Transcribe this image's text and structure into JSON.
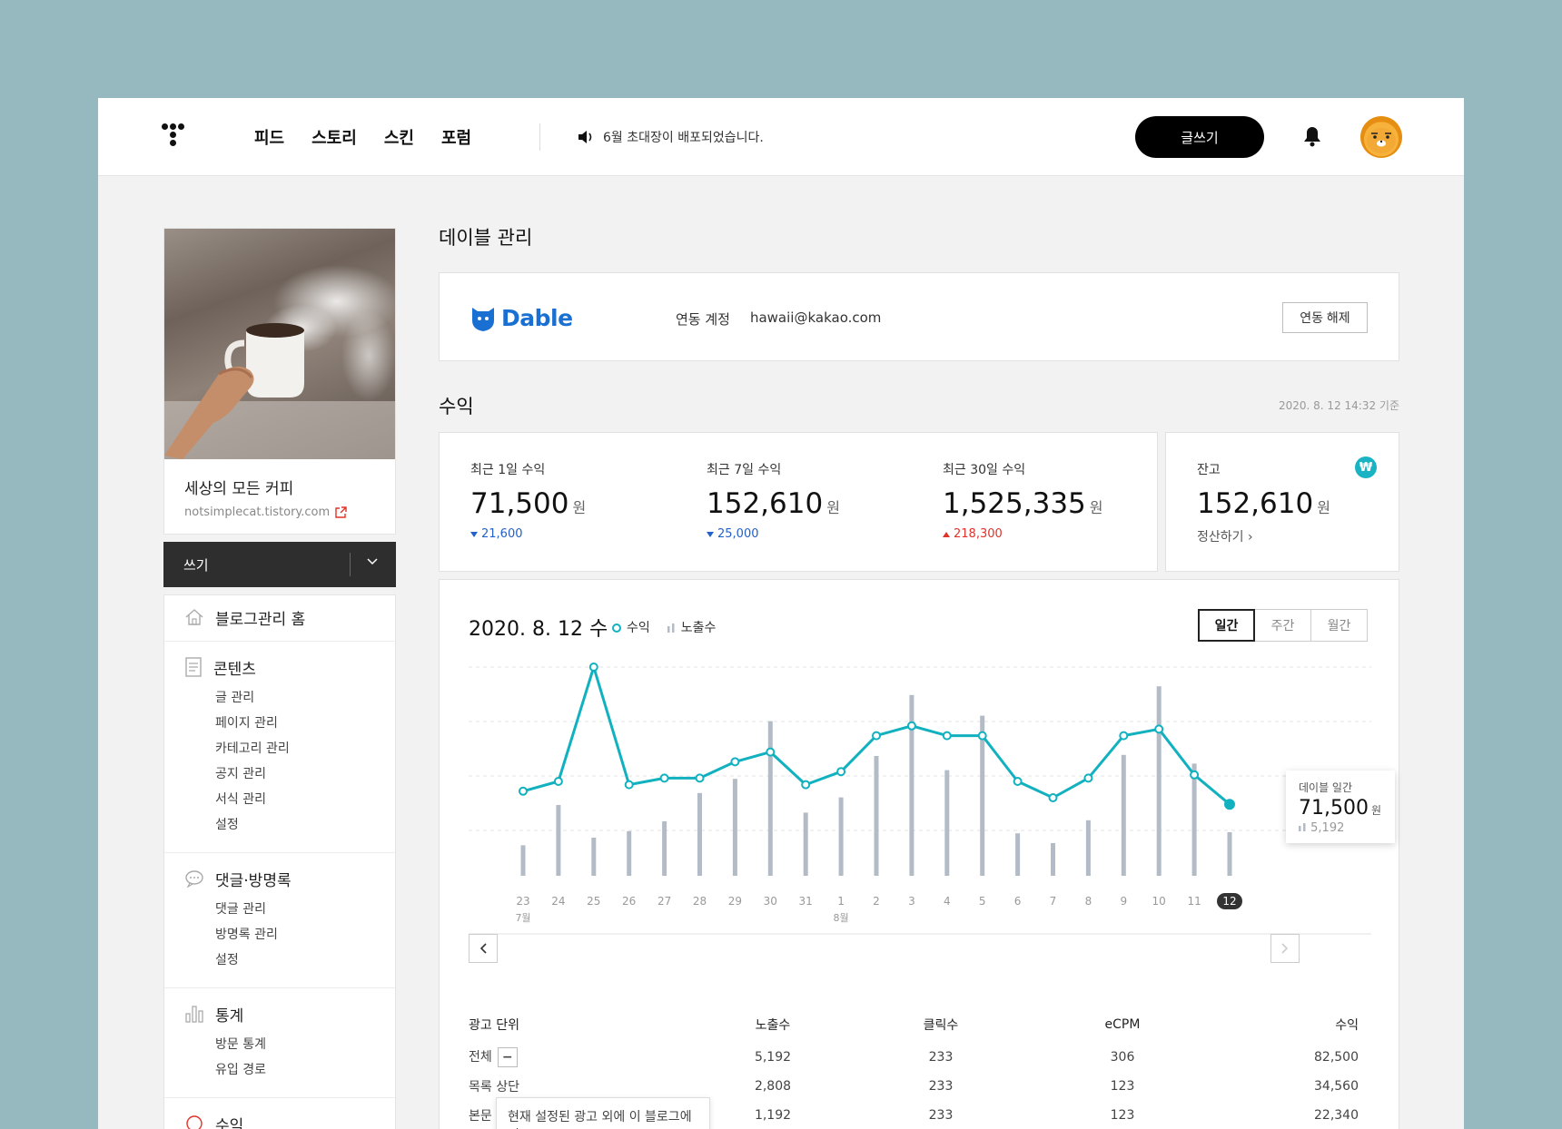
{
  "header": {
    "nav": [
      "피드",
      "스토리",
      "스킨",
      "포럼"
    ],
    "notice": "6월 초대장이 배포되었습니다.",
    "write_label": "글쓰기"
  },
  "sidebar": {
    "blog_title": "세상의 모든 커피",
    "blog_url": "notsimplecat.tistory.com",
    "write_label": "쓰기",
    "home_label": "블로그관리 홈",
    "groups": [
      {
        "title": "콘텐츠",
        "icon": "document-icon",
        "items": [
          "글 관리",
          "페이지 관리",
          "카테고리 관리",
          "공지 관리",
          "서식 관리",
          "설정"
        ]
      },
      {
        "title": "댓글·방명록",
        "icon": "comment-icon",
        "items": [
          "댓글 관리",
          "방명록 관리",
          "설정"
        ]
      },
      {
        "title": "통계",
        "icon": "stats-icon",
        "items": [
          "방문 통계",
          "유입 경로"
        ]
      }
    ],
    "next_group": "수익"
  },
  "dable": {
    "title": "데이블 관리",
    "logo_text": "Dable",
    "account_label": "연동 계정",
    "account_value": "hawaii@kakao.com",
    "unlink_label": "연동 해제"
  },
  "revenue": {
    "title": "수익",
    "as_of": "2020. 8. 12 14:32 기준",
    "stats": [
      {
        "label": "최근 1일 수익",
        "value": "71,500",
        "unit": "원",
        "delta": "21,600",
        "dir": "down"
      },
      {
        "label": "최근 7일 수익",
        "value": "152,610",
        "unit": "원",
        "delta": "25,000",
        "dir": "down"
      },
      {
        "label": "최근 30일 수익",
        "value": "1,525,335",
        "unit": "원",
        "delta": "218,300",
        "dir": "up"
      }
    ],
    "balance": {
      "label": "잔고",
      "value": "152,610",
      "unit": "원",
      "settle": "정산하기",
      "icon_text": "₩"
    }
  },
  "chart": {
    "date": "2020. 8. 12 수",
    "legend_revenue": "수익",
    "legend_views": "노출수",
    "periods": [
      "일간",
      "주간",
      "월간"
    ],
    "tooltip": {
      "title": "데이블 일간",
      "value": "71,500",
      "unit": "원",
      "views": "5,192"
    }
  },
  "chart_data": {
    "type": "line",
    "categories": [
      "23",
      "24",
      "25",
      "26",
      "27",
      "28",
      "29",
      "30",
      "31",
      "1",
      "2",
      "3",
      "4",
      "5",
      "6",
      "7",
      "8",
      "9",
      "10",
      "11",
      "12"
    ],
    "month_labels": {
      "0": "7월",
      "9": "8월"
    },
    "selected_index": 20,
    "series": [
      {
        "name": "수익",
        "kind": "line",
        "color": "#11b1bf",
        "values": [
          62,
          65,
          100,
          64,
          66,
          66,
          71,
          74,
          64,
          68,
          79,
          82,
          79,
          79,
          65,
          60,
          66,
          79,
          81,
          67,
          58
        ]
      },
      {
        "name": "노출수",
        "kind": "bar",
        "color": "#b3bcc6",
        "values": [
          28,
          65,
          35,
          41,
          50,
          76,
          89,
          142,
          58,
          72,
          110,
          166,
          97,
          147,
          39,
          30,
          51,
          111,
          174,
          103,
          40
        ]
      }
    ]
  },
  "table": {
    "headers": [
      "광고 단위",
      "노출수",
      "클릭수",
      "eCPM",
      "수익"
    ],
    "rows": [
      [
        "전체",
        "5,192",
        "233",
        "306",
        "82,500"
      ],
      [
        "목록 상단",
        "2,808",
        "233",
        "123",
        "34,560"
      ],
      [
        "본문",
        "1,192",
        "233",
        "123",
        "22,340"
      ]
    ],
    "tooltip": "현재 설정된 광고 외에 이 블로그에서"
  }
}
